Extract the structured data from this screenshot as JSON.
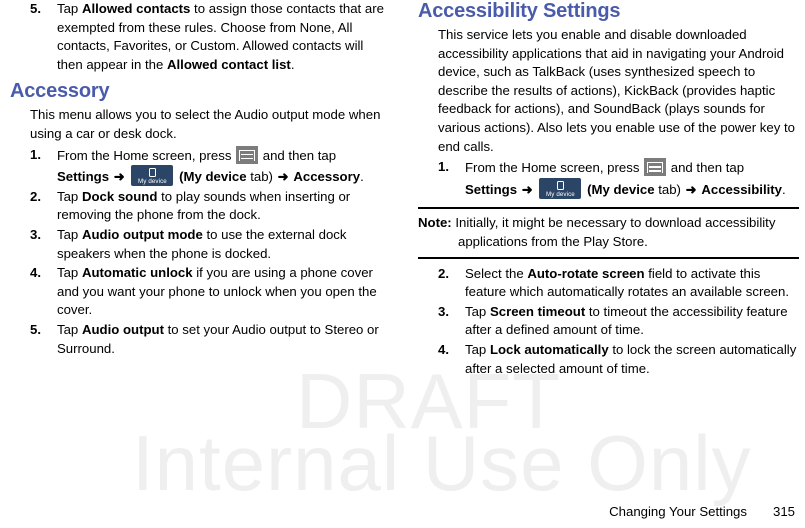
{
  "watermark": {
    "line1": "DRAFT",
    "line2": "Internal Use Only"
  },
  "footer": {
    "title": "Changing Your Settings",
    "page_number": "315"
  },
  "icons": {
    "menu_icon_name": "menu-key-icon",
    "my_device_label": "My device"
  },
  "colors": {
    "heading_blue": "#4a5bab",
    "menu_icon_gray": "#7c7c7c",
    "my_device_navy": "#2b4566",
    "watermark_gray": "#efefef"
  },
  "left_column": {
    "continued_step": {
      "number": "5.",
      "part1": "Tap ",
      "bold1": "Allowed contacts",
      "part2": " to assign those contacts that are exempted from these rules. Choose from None, All contacts, Favorites, or Custom. Allowed contacts will then appear in the ",
      "bold2": "Allowed contact list",
      "part3": "."
    },
    "heading": "Accessory",
    "intro": "This menu allows you to select the Audio output mode when using a car or desk dock.",
    "steps": [
      {
        "number": "1.",
        "line1_pre": "From the Home screen, press ",
        "line1_post": " and then tap",
        "line2_settings": "Settings",
        "line2_arrow1": "➜",
        "line2_tab_open": "(",
        "line2_tab_bold": "My device",
        "line2_tab_rest": " tab)",
        "line2_arrow2": "➜",
        "line2_target": "Accessory",
        "line2_period": "."
      },
      {
        "number": "2.",
        "pre": "Tap ",
        "bold": "Dock sound",
        "post": " to play sounds when inserting or removing the phone from the dock."
      },
      {
        "number": "3.",
        "pre": "Tap ",
        "bold": "Audio output mode",
        "post": " to use the external dock speakers when the phone is docked."
      },
      {
        "number": "4.",
        "pre": "Tap ",
        "bold": "Automatic unlock",
        "post": " if you are using a phone cover and you want your phone to unlock when you open the cover."
      },
      {
        "number": "5.",
        "pre": "Tap ",
        "bold": "Audio output",
        "post": " to set your Audio output to Stereo or Surround."
      }
    ]
  },
  "right_column": {
    "heading": "Accessibility Settings",
    "intro": "This service lets you enable and disable downloaded accessibility applications that aid in navigating your Android device, such as TalkBack (uses synthesized speech to describe the results of actions), KickBack (provides haptic feedback for actions), and SoundBack (plays sounds for various actions). Also lets you enable use of the power key to end calls.",
    "step1": {
      "number": "1.",
      "line1_pre": "From the Home screen, press ",
      "line1_post": " and then tap",
      "line2_settings": "Settings",
      "line2_arrow1": "➜",
      "line2_tab_open": "(",
      "line2_tab_bold": "My device",
      "line2_tab_rest": " tab)",
      "line2_arrow2": "➜",
      "line2_target": "Accessibility",
      "line2_period": "."
    },
    "note": {
      "label": "Note:",
      "text": " Initially, it might be necessary to download accessibility",
      "text_line2": "applications from the Play Store."
    },
    "steps_after_note": [
      {
        "number": "2.",
        "pre": "Select the ",
        "bold": "Auto-rotate screen",
        "post": " field to activate this feature which automatically rotates an available screen."
      },
      {
        "number": "3.",
        "pre": "Tap ",
        "bold": "Screen timeout",
        "post": " to timeout the accessibility feature after a defined amount of time."
      },
      {
        "number": "4.",
        "pre": "Tap ",
        "bold": "Lock automatically",
        "post": " to lock the screen automatically after a selected amount of time."
      }
    ]
  }
}
